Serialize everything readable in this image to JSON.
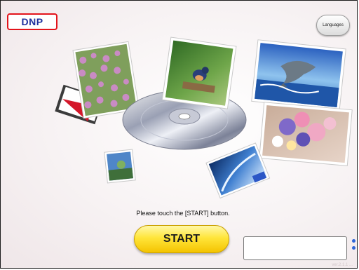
{
  "brand": {
    "logo_text": "DNP"
  },
  "header": {
    "languages_label": "Languages"
  },
  "main": {
    "prompt_text": "Please touch the [START] button.",
    "start_label": "START"
  },
  "footer": {
    "version_text": "ver.2.1.1  ..."
  },
  "colors": {
    "logo_border": "#e3141b",
    "logo_text": "#1c2f9e",
    "start_button": "#ffe53a",
    "scroll_indicator": "#2d66d8"
  },
  "icons": {
    "collage": "photo-cd-collage",
    "scroll": "scroll-dots-icon"
  }
}
